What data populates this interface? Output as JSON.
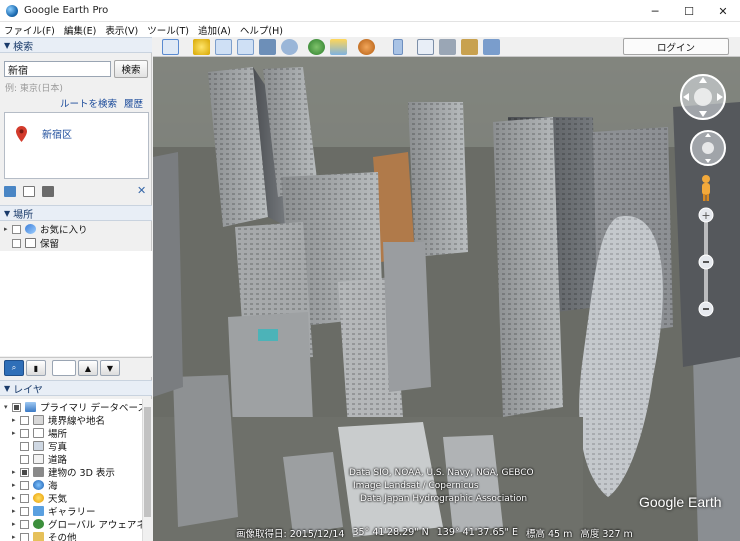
{
  "window": {
    "title": "Google Earth Pro",
    "minimize": "─",
    "maximize": "☐",
    "close": "✕"
  },
  "menu": [
    "ファイル(F)",
    "編集(E)",
    "表示(V)",
    "ツール(T)",
    "追加(A)",
    "ヘルプ(H)"
  ],
  "search": {
    "header": "検索",
    "value": "新宿",
    "button": "検索",
    "example": "例: 東京(日本)",
    "route_link": "ルートを検索",
    "history_link": "履歴",
    "result": "新宿区",
    "close": "✕"
  },
  "places": {
    "header": "場所",
    "items": [
      {
        "label": "お気に入り",
        "icon": "favorites-icon"
      },
      {
        "label": "保留",
        "icon": "folder-icon"
      }
    ]
  },
  "layers": {
    "header": "レイヤ",
    "items": [
      {
        "label": "プライマリ データベース",
        "icon": "database-icon"
      },
      {
        "label": "境界線や地名",
        "icon": "borders-icon"
      },
      {
        "label": "場所",
        "icon": "places-icon"
      },
      {
        "label": "写真",
        "icon": "photos-icon"
      },
      {
        "label": "道路",
        "icon": "roads-icon"
      },
      {
        "label": "建物の 3D 表示",
        "icon": "buildings-3d-icon"
      },
      {
        "label": "海",
        "icon": "ocean-icon"
      },
      {
        "label": "天気",
        "icon": "weather-icon"
      },
      {
        "label": "ギャラリー",
        "icon": "gallery-icon"
      },
      {
        "label": "グローバル アウェアネス",
        "icon": "global-awareness-icon"
      },
      {
        "label": "その他",
        "icon": "more-icon"
      }
    ]
  },
  "toolbar": {
    "login": "ログイン"
  },
  "map": {
    "attribution": [
      "Data SIO, NOAA, U.S. Navy, NGA, GEBCO",
      "Image Landsat / Copernicus",
      "Data Japan Hydrographic Association"
    ],
    "logo": "Google Earth",
    "status": {
      "date": "画像取得日: 2015/12/14",
      "lat": "35° 41'28.29\" N",
      "lon": "139° 41'37.65\" E",
      "elev": "標高   45 m",
      "alt": "高度   327 m"
    }
  },
  "colors": {
    "accent": "#1a4a9a",
    "header_bg": "#e8eef6",
    "pin": "#d33b2c"
  }
}
